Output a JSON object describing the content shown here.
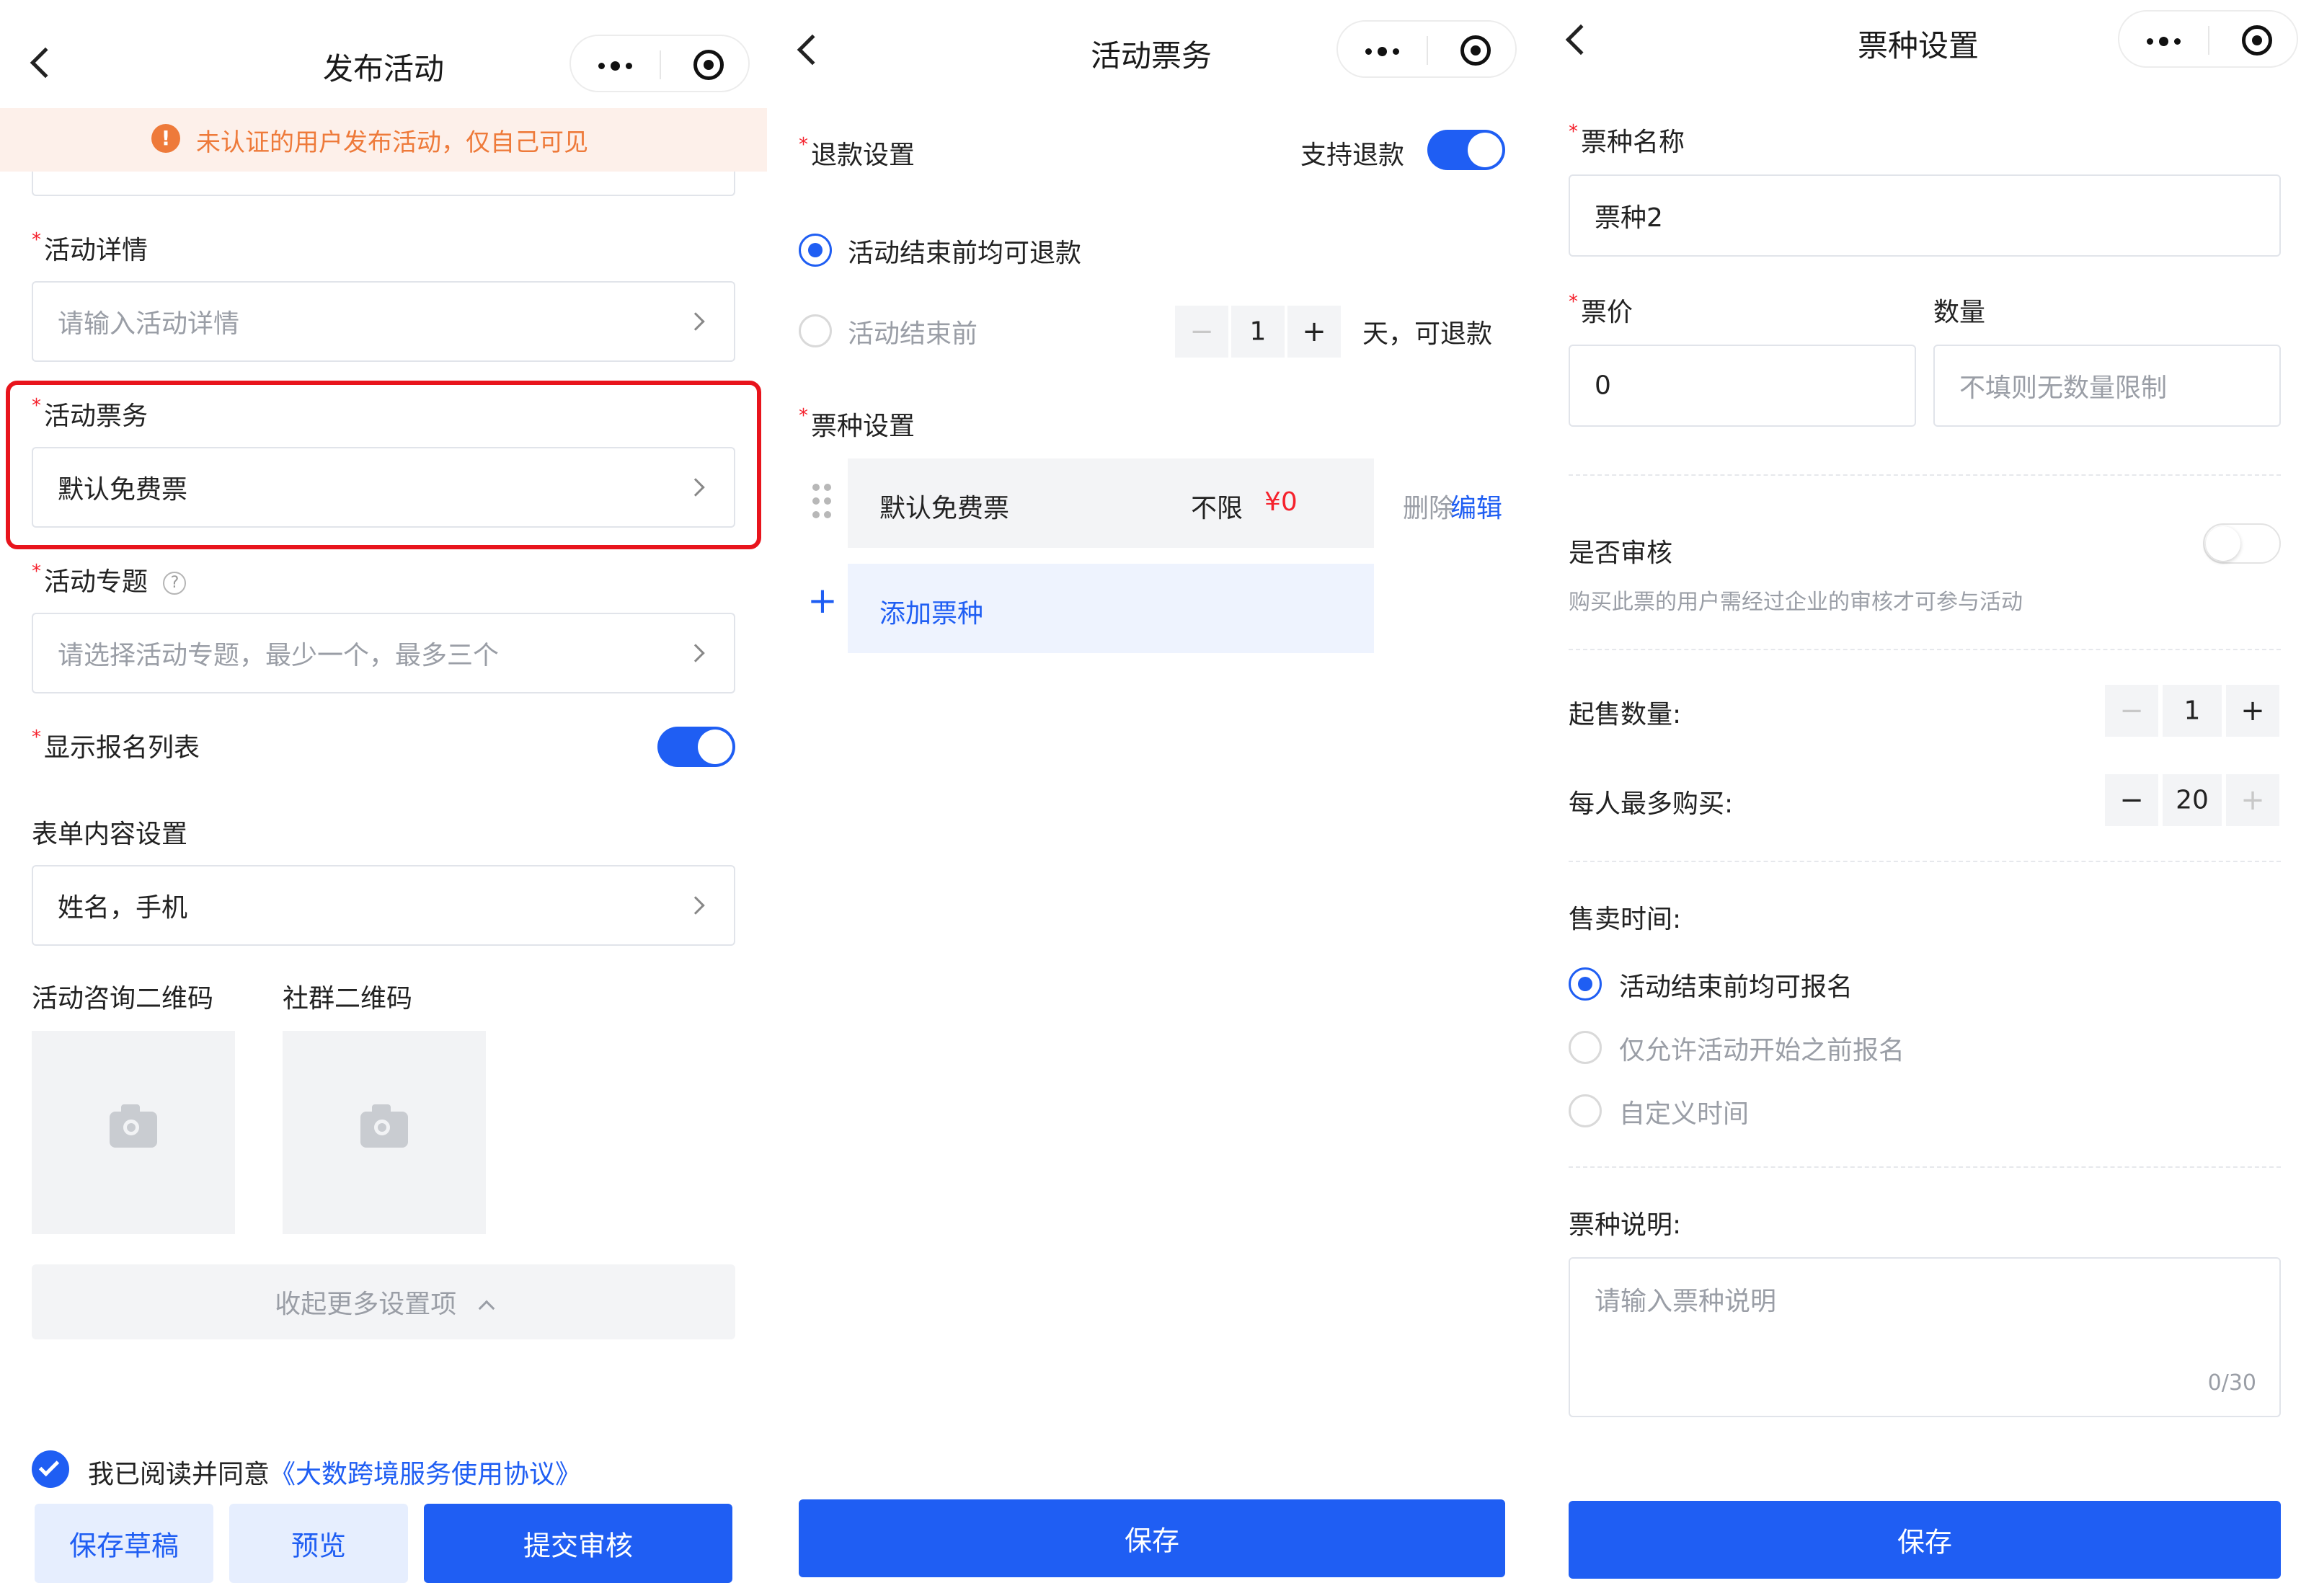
{
  "p1": {
    "title": "发布活动",
    "notice": "未认证的用户发布活动，仅自己可见",
    "notice_icon": "!",
    "detail_label": "活动详情",
    "detail_placeholder": "请输入活动详情",
    "ticket_label": "活动票务",
    "ticket_value": "默认免费票",
    "topic_label": "活动专题",
    "topic_help": "?",
    "topic_placeholder": "请选择活动专题，最少一个，最多三个",
    "show_list_label": "显示报名列表",
    "show_list_on": true,
    "form_label": "表单内容设置",
    "form_value": "姓名，手机",
    "qr1_label": "活动咨询二维码",
    "qr2_label": "社群二维码",
    "collapse_label": "收起更多设置项",
    "agree_text": "我已阅读并同意",
    "agree_link": "《大数跨境服务使用协议》",
    "save_draft": "保存草稿",
    "preview": "预览",
    "submit": "提交审核"
  },
  "p2": {
    "title": "活动票务",
    "refund_label": "退款设置",
    "refund_toggle_label": "支持退款",
    "refund_on": true,
    "option1": "活动结束前均可退款",
    "option2": "活动结束前",
    "days_value": "1",
    "minus": "−",
    "plus": "+",
    "days_suffix": "天，可退款",
    "ticket_types_label": "票种设置",
    "ticket_name": "默认免费票",
    "ticket_limit": "不限",
    "ticket_price": "¥0",
    "delete": "删除",
    "edit": "编辑",
    "add_icon": "+",
    "add_ticket": "添加票种",
    "save": "保存"
  },
  "p3": {
    "title": "票种设置",
    "name_label": "票种名称",
    "name_value": "票种2",
    "price_label": "票价",
    "price_value": "0",
    "qty_label": "数量",
    "qty_placeholder": "不填则无数量限制",
    "review_label": "是否审核",
    "review_desc": "购买此票的用户需经过企业的审核才可参与活动",
    "review_on": false,
    "min_label": "起售数量:",
    "min_value": "1",
    "max_label": "每人最多购买:",
    "max_value": "20",
    "minus": "−",
    "plus": "+",
    "sale_time_label": "售卖时间:",
    "sale_opt1": "活动结束前均可报名",
    "sale_opt2": "仅允许活动开始之前报名",
    "sale_opt3": "自定义时间",
    "desc_label": "票种说明:",
    "desc_placeholder": "请输入票种说明",
    "desc_count": "0/30",
    "save": "保存"
  },
  "colors": {
    "primary": "#1f5ef3",
    "required": "#f5222d",
    "price": "#f5222d",
    "notice_bg": "#fdf0ea",
    "notice_text": "#ee7a3a",
    "highlight_border": "#e8141c"
  }
}
